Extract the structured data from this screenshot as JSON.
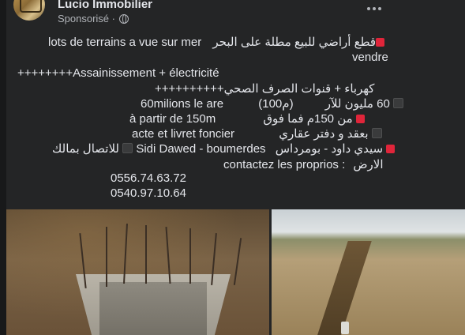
{
  "post": {
    "author": "Lucio Immobilier",
    "sponsored": "Sponsorisé ·",
    "lines": {
      "l1a": "lots de terrains a  vue sur mer",
      "l1b": "قطع أراضي للبيع  مطلة على البحر",
      "l2": "vendre",
      "l3": "++++++++Assainissement + électricité",
      "l4": "++++++++++كهرباء + قنوات الصرف الصحي",
      "l5a": "60milions le are",
      "l5b": "(100م)",
      "l5c": "60 مليون للآر",
      "l6a": "à partir de 150m",
      "l6b": "من 150م فما فوق",
      "l7a": "acte et livret foncier",
      "l7b": "بعقد و دفتر عقاري",
      "l8a": "Sidi Dawed - boumerdes",
      "l8b": "سيدي داود - بومرداس",
      "l8c": "للاتصال بمالك",
      "l9a": "contactez les proprios   :",
      "l9b": "الارض",
      "phone1": "0556.74.63.72",
      "phone2": "0540.97.10.64"
    },
    "icons": {
      "red_square": "red-square-emoji",
      "black_square": "black-square-emoji",
      "globe": "globe-icon",
      "more": "more-options-icon"
    },
    "images": [
      "construction-pit-photo",
      "trench-photo"
    ]
  }
}
